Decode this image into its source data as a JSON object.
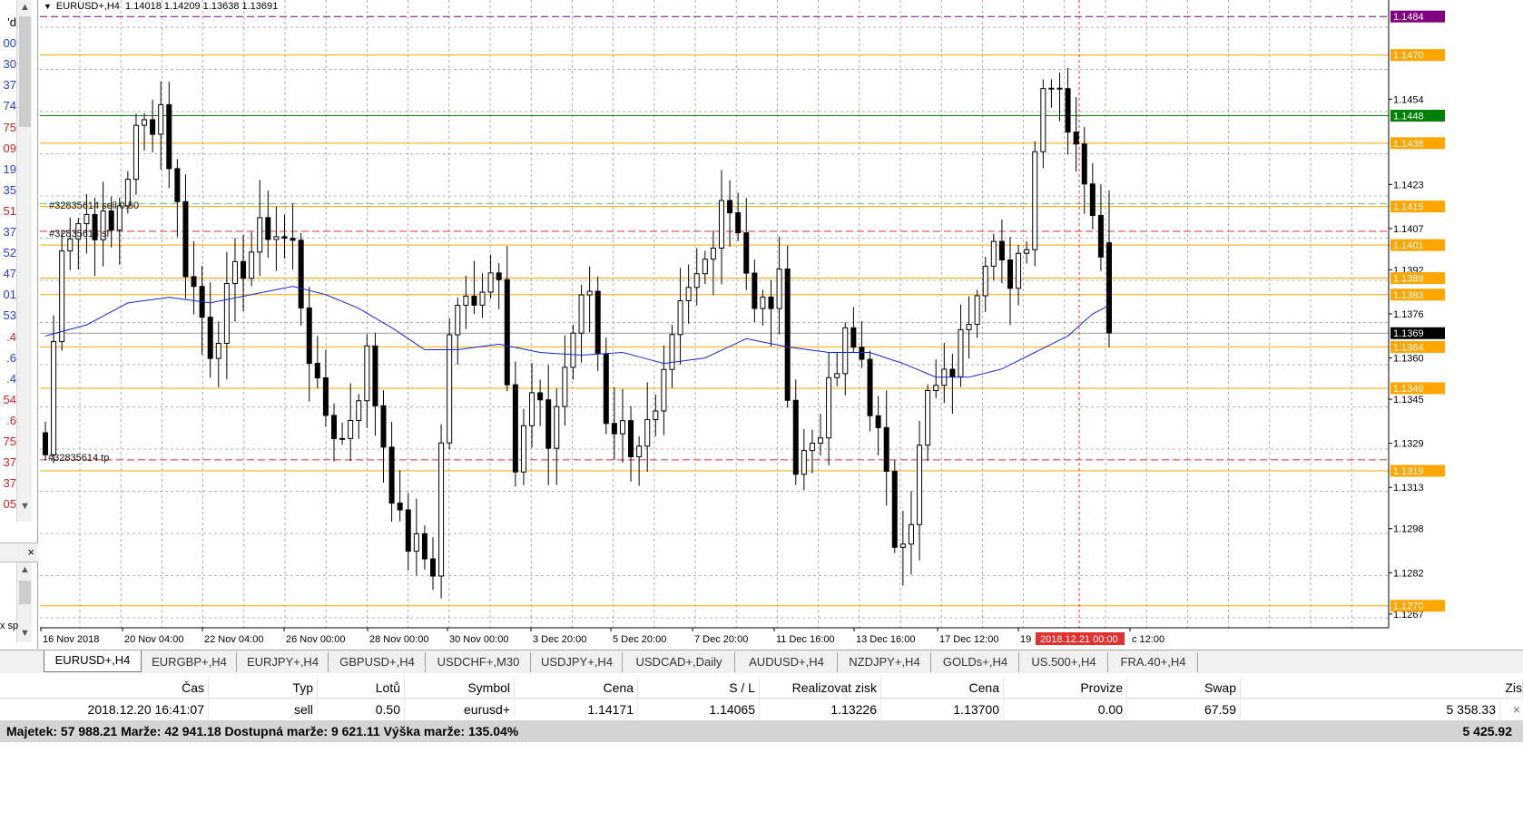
{
  "left_panel": {
    "quotes": [
      {
        "text": "'d",
        "color": "#000000"
      },
      {
        "text": "00",
        "color": "#1f3fd8"
      },
      {
        "text": "30",
        "color": "#1f3fd8"
      },
      {
        "text": "37",
        "color": "#1f3fd8"
      },
      {
        "text": "74",
        "color": "#1f3fd8"
      },
      {
        "text": "75",
        "color": "#d42020"
      },
      {
        "text": "09",
        "color": "#d42020"
      },
      {
        "text": "19",
        "color": "#1f3fd8"
      },
      {
        "text": "35",
        "color": "#1f3fd8"
      },
      {
        "text": "51",
        "color": "#d42020"
      },
      {
        "text": "37",
        "color": "#1f3fd8"
      },
      {
        "text": "52",
        "color": "#1f3fd8"
      },
      {
        "text": "47",
        "color": "#1f3fd8"
      },
      {
        "text": "01",
        "color": "#1f3fd8"
      },
      {
        "text": "53",
        "color": "#1f3fd8"
      },
      {
        "text": ".4",
        "color": "#d42020"
      },
      {
        "text": ".6",
        "color": "#1f3fd8"
      },
      {
        "text": ".4",
        "color": "#1f3fd8"
      },
      {
        "text": "54",
        "color": "#d42020"
      },
      {
        "text": ".6",
        "color": "#d42020"
      },
      {
        "text": "75",
        "color": "#d42020"
      },
      {
        "text": "37",
        "color": "#d42020"
      },
      {
        "text": "37",
        "color": "#d42020"
      },
      {
        "text": "05",
        "color": "#d42020"
      }
    ],
    "close_glyph": "×",
    "partial_label": "x sp"
  },
  "chart": {
    "header": {
      "symbol": "EURUSD+,H4",
      "ohlc": "1.14018 1.14209 1.13638 1.13691"
    },
    "crosshair_time": "2018.12.21 00:00",
    "x_labels": [
      {
        "text": "16 Nov 2018"
      },
      {
        "text": "20 Nov 04:00"
      },
      {
        "text": "22 Nov 04:00"
      },
      {
        "text": "26 Nov 00:00"
      },
      {
        "text": "28 Nov 00:00"
      },
      {
        "text": "30 Nov 00:00"
      },
      {
        "text": "3 Dec 20:00"
      },
      {
        "text": "5 Dec 20:00"
      },
      {
        "text": "7 Dec 20:00"
      },
      {
        "text": "11 Dec 16:00"
      },
      {
        "text": "13 Dec 16:00"
      },
      {
        "text": "17 Dec 12:00"
      },
      {
        "text": "19"
      },
      {
        "text": "c 12:00"
      }
    ],
    "price_ticks": [
      "1.1454",
      "1.1423",
      "1.1407",
      "1.1392",
      "1.1376",
      "1.1360",
      "1.1345",
      "1.1329",
      "1.1313",
      "1.1298",
      "1.1282",
      "1.1267"
    ],
    "level_badges": [
      {
        "text": "1.1484",
        "price": 1.1484,
        "bg": "#800080",
        "fg": "#ffffff"
      },
      {
        "text": "1.1470",
        "price": 1.147,
        "bg": "#ffa500",
        "fg": "#ffffff"
      },
      {
        "text": "1.1448",
        "price": 1.1448,
        "bg": "#008000",
        "fg": "#ffffff"
      },
      {
        "text": "1.1438",
        "price": 1.1438,
        "bg": "#ffa500",
        "fg": "#ffffff"
      },
      {
        "text": "1.1415",
        "price": 1.1415,
        "bg": "#ffa500",
        "fg": "#ffffff"
      },
      {
        "text": "1.1401",
        "price": 1.1401,
        "bg": "#ffa500",
        "fg": "#ffffff"
      },
      {
        "text": "1.1389",
        "price": 1.1389,
        "bg": "#ffa500",
        "fg": "#ffffff"
      },
      {
        "text": "1.1383",
        "price": 1.1383,
        "bg": "#ffa500",
        "fg": "#ffffff"
      },
      {
        "text": "1.1369",
        "price": 1.1369,
        "bg": "#000000",
        "fg": "#ffffff"
      },
      {
        "text": "1.1364",
        "price": 1.1364,
        "bg": "#ffa500",
        "fg": "#ffffff"
      },
      {
        "text": "1.1349",
        "price": 1.1349,
        "bg": "#ffa500",
        "fg": "#ffffff"
      },
      {
        "text": "1.1319",
        "price": 1.1319,
        "bg": "#ffa500",
        "fg": "#ffffff"
      },
      {
        "text": "1.1270",
        "price": 1.127,
        "bg": "#ffa500",
        "fg": "#ffffff"
      }
    ],
    "trade_labels": {
      "order": "#32835614 sell 0.50",
      "stop_loss": "#32835614 sl",
      "take_profit": "#32835614 tp"
    },
    "colors": {
      "grid": "#9a9a9a",
      "hline": "#ffa500",
      "ma": "#1428d0",
      "candle": "#000000",
      "crosshair": "#e03030"
    }
  },
  "chart_data": {
    "type": "candlestick",
    "symbol": "EURUSD+",
    "timeframe": "H4",
    "ylim": [
      1.1262,
      1.149
    ],
    "candle_count": 130,
    "close_anchors": [
      [
        0,
        1.1325
      ],
      [
        2,
        1.1405
      ],
      [
        5,
        1.1412
      ],
      [
        8,
        1.1405
      ],
      [
        11,
        1.144
      ],
      [
        14,
        1.1452
      ],
      [
        17,
        1.1395
      ],
      [
        20,
        1.1365
      ],
      [
        22,
        1.138
      ],
      [
        24,
        1.1395
      ],
      [
        27,
        1.1408
      ],
      [
        30,
        1.14
      ],
      [
        33,
        1.1345
      ],
      [
        36,
        1.133
      ],
      [
        39,
        1.136
      ],
      [
        41,
        1.133
      ],
      [
        43,
        1.1298
      ],
      [
        45,
        1.129
      ],
      [
        47,
        1.1285
      ],
      [
        49,
        1.137
      ],
      [
        52,
        1.1385
      ],
      [
        55,
        1.1395
      ],
      [
        57,
        1.132
      ],
      [
        59,
        1.1345
      ],
      [
        61,
        1.133
      ],
      [
        64,
        1.137
      ],
      [
        66,
        1.1385
      ],
      [
        68,
        1.134
      ],
      [
        71,
        1.133
      ],
      [
        74,
        1.1335
      ],
      [
        77,
        1.1375
      ],
      [
        80,
        1.1395
      ],
      [
        82,
        1.142
      ],
      [
        84,
        1.141
      ],
      [
        86,
        1.1375
      ],
      [
        89,
        1.1385
      ],
      [
        91,
        1.132
      ],
      [
        93,
        1.133
      ],
      [
        95,
        1.1345
      ],
      [
        97,
        1.1365
      ],
      [
        99,
        1.136
      ],
      [
        101,
        1.133
      ],
      [
        103,
        1.1295
      ],
      [
        105,
        1.1305
      ],
      [
        107,
        1.1345
      ],
      [
        109,
        1.135
      ],
      [
        111,
        1.1365
      ],
      [
        113,
        1.139
      ],
      [
        115,
        1.141
      ],
      [
        117,
        1.138
      ],
      [
        119,
        1.1405
      ],
      [
        121,
        1.1465
      ],
      [
        123,
        1.1458
      ],
      [
        125,
        1.144
      ],
      [
        127,
        1.1415
      ],
      [
        129,
        1.1369
      ]
    ],
    "ma_anchors": [
      [
        0,
        1.1368
      ],
      [
        5,
        1.1372
      ],
      [
        10,
        1.138
      ],
      [
        15,
        1.1382
      ],
      [
        20,
        1.138
      ],
      [
        25,
        1.1383
      ],
      [
        30,
        1.1386
      ],
      [
        34,
        1.1383
      ],
      [
        38,
        1.1378
      ],
      [
        42,
        1.1371
      ],
      [
        46,
        1.1363
      ],
      [
        50,
        1.1363
      ],
      [
        55,
        1.1365
      ],
      [
        60,
        1.1362
      ],
      [
        65,
        1.1361
      ],
      [
        70,
        1.1362
      ],
      [
        75,
        1.1358
      ],
      [
        80,
        1.136
      ],
      [
        85,
        1.1367
      ],
      [
        90,
        1.1364
      ],
      [
        95,
        1.1362
      ],
      [
        100,
        1.1362
      ],
      [
        104,
        1.1358
      ],
      [
        108,
        1.1353
      ],
      [
        112,
        1.1353
      ],
      [
        116,
        1.1356
      ],
      [
        120,
        1.1362
      ],
      [
        124,
        1.1368
      ],
      [
        127,
        1.1376
      ],
      [
        129,
        1.1379
      ]
    ],
    "lines": [
      {
        "price": 1.1484,
        "color": "#800080",
        "style": "dash"
      },
      {
        "price": 1.147,
        "color": "#ffa500",
        "style": "solid"
      },
      {
        "price": 1.1448,
        "color": "#008000",
        "style": "solid"
      },
      {
        "price": 1.1438,
        "color": "#ffa500",
        "style": "solid"
      },
      {
        "price": 1.1416,
        "color": "#66cc66",
        "style": "dash"
      },
      {
        "price": 1.1415,
        "color": "#ffa500",
        "style": "solid"
      },
      {
        "price": 1.1406,
        "color": "#e03030",
        "style": "dash"
      },
      {
        "price": 1.1401,
        "color": "#ffa500",
        "style": "solid"
      },
      {
        "price": 1.1389,
        "color": "#ffa500",
        "style": "solid"
      },
      {
        "price": 1.1383,
        "color": "#ffa500",
        "style": "solid"
      },
      {
        "price": 1.1369,
        "color": "#9a9a9a",
        "style": "solid"
      },
      {
        "price": 1.1364,
        "color": "#ffa500",
        "style": "solid"
      },
      {
        "price": 1.1349,
        "color": "#ffa500",
        "style": "solid"
      },
      {
        "price": 1.1323,
        "color": "#e03030",
        "style": "dash"
      },
      {
        "price": 1.1319,
        "color": "#ffa500",
        "style": "solid"
      },
      {
        "price": 1.127,
        "color": "#ffa500",
        "style": "solid"
      }
    ]
  },
  "tabs": [
    {
      "label": "EURUSD+,H4",
      "active": true
    },
    {
      "label": "EURGBP+,H4"
    },
    {
      "label": "EURJPY+,H4"
    },
    {
      "label": "GBPUSD+,H4"
    },
    {
      "label": "USDCHF+,M30"
    },
    {
      "label": "USDJPY+,H4"
    },
    {
      "label": "USDCAD+,Daily"
    },
    {
      "label": "AUDUSD+,H4"
    },
    {
      "label": "NZDJPY+,H4"
    },
    {
      "label": "GOLDs+,H4"
    },
    {
      "label": "US.500+,H4"
    },
    {
      "label": "FRA.40+,H4"
    }
  ],
  "trade_table": {
    "headers": [
      "Čas",
      "Typ",
      "Lotů",
      "Symbol",
      "Cena",
      "S / L",
      "Realizovat zisk",
      "Cena",
      "Provize",
      "Swap",
      "Zis"
    ],
    "row": [
      "2018.12.20 16:41:07",
      "sell",
      "0.50",
      "eurusd+",
      "1.14171",
      "1.14065",
      "1.13226",
      "1.13700",
      "0.00",
      "67.59",
      "5 358.33"
    ],
    "row_close": "×",
    "summary": "Majetek: 57 988.21  Marže: 42 941.18  Dostupná marže: 9 621.11  Výška marže: 135.04%",
    "summary_profit": "5 425.92"
  }
}
